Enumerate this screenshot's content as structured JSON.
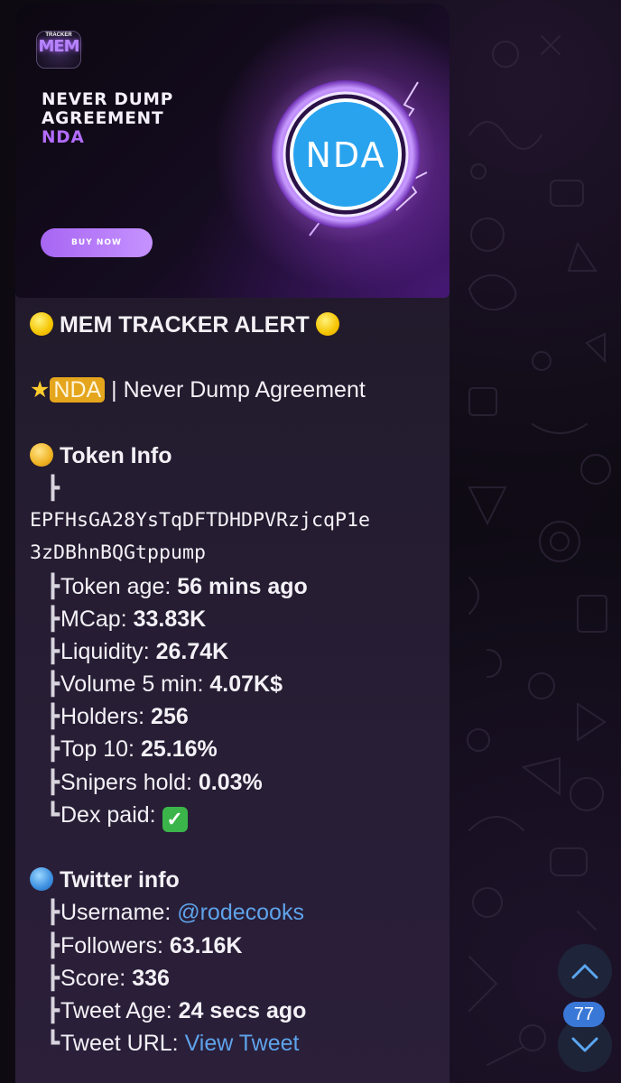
{
  "banner": {
    "logo_text": "MEM",
    "logo_subtext": "TRACKER",
    "title_line1": "NEVER DUMP",
    "title_line2": "AGREEMENT",
    "ticker": "NDA",
    "buy_button": "BUY NOW",
    "coin_text": "NDA"
  },
  "message": {
    "alert_title": "MEM TRACKER ALERT",
    "token_tag": "NDA",
    "token_name": "| Never Dump Agreement",
    "token_info_header": "Token Info",
    "contract_line1": "EPFHsGA28YsTqDFTDHDPVRzjcqP1e",
    "contract_line2": "3zDBhnBQGtppump",
    "token_rows": [
      {
        "label": "Token age: ",
        "value": "56 mins ago"
      },
      {
        "label": "MCap: ",
        "value": "33.83K"
      },
      {
        "label": "Liquidity: ",
        "value": "26.74K"
      },
      {
        "label": "Volume 5 min: ",
        "value": "4.07K$"
      },
      {
        "label": "Holders: ",
        "value": "256"
      },
      {
        "label": "Top 10: ",
        "value": "25.16%"
      },
      {
        "label": "Snipers hold: ",
        "value": "0.03%"
      },
      {
        "label": "Dex paid: ",
        "value": "✓"
      }
    ],
    "twitter_header": "Twitter info",
    "twitter_rows": [
      {
        "label": "Username: ",
        "value": "@rodecooks"
      },
      {
        "label": "Followers: ",
        "value": "63.16K"
      },
      {
        "label": "Score: ",
        "value": "336"
      },
      {
        "label": "Tweet Age: ",
        "value": "24 secs ago"
      },
      {
        "label": "Tweet URL: ",
        "value": "View Tweet"
      }
    ]
  },
  "scroll": {
    "unread_count": "77"
  },
  "colors": {
    "accent_purple": "#b26cff",
    "link_blue": "#5ea3ea",
    "tag_gold": "#e5a61d",
    "badge_blue": "#3a78d8"
  }
}
